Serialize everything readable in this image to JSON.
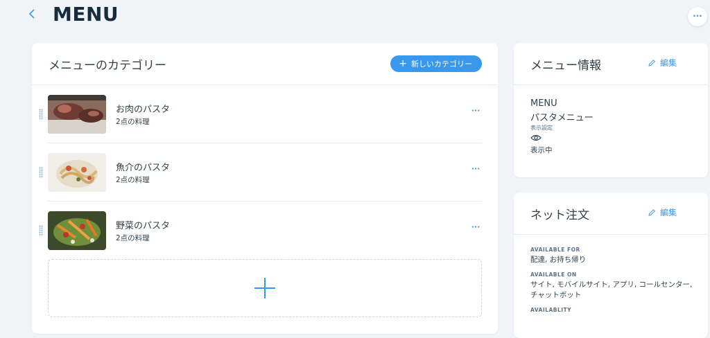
{
  "header": {
    "title": "MENU"
  },
  "categories_card": {
    "title": "メニューのカテゴリー",
    "new_button_label": "新しいカテゴリー",
    "items": [
      {
        "name": "お肉のパスタ",
        "count": "2点の料理"
      },
      {
        "name": "魚介のパスタ",
        "count": "2点の料理"
      },
      {
        "name": "野菜のパスタ",
        "count": "2点の料理"
      }
    ]
  },
  "info_card": {
    "title": "メニュー情報",
    "edit_label": "編集",
    "menu_name": "MENU",
    "menu_description": "パスタメニュー",
    "visibility_label": "表示設定",
    "visibility_status": "表示中"
  },
  "order_card": {
    "title": "ネット注文",
    "edit_label": "編集",
    "available_for_label": "AVAILABLE FOR",
    "available_for_value": "配達, お持ち帰り",
    "available_on_label": "AVAILABLE ON",
    "available_on_value": "サイト, モバイルサイト, アプリ, コールセンター, チャットボット",
    "availability_label": "AVAILABLITY"
  },
  "colors": {
    "accent": "#3899ec",
    "background": "#f0f4f7",
    "text": "#32404b"
  }
}
